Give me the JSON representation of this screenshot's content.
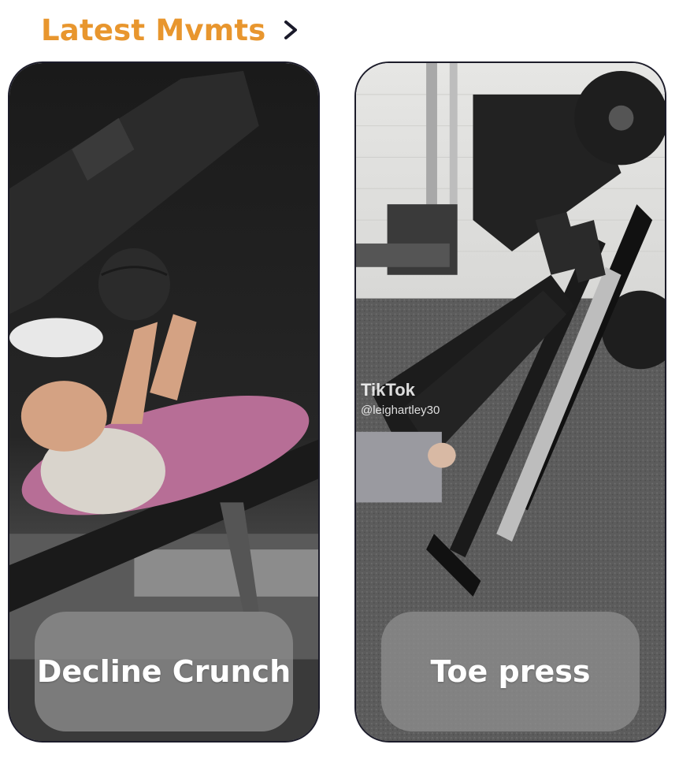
{
  "section": {
    "title": "Latest Mvmts",
    "chevron_icon": "chevron-right-icon"
  },
  "cards": [
    {
      "label": "Decline Crunch"
    },
    {
      "label": "Toe press",
      "watermark_brand": "TikTok",
      "watermark_handle": "@leighartley30"
    }
  ],
  "colors": {
    "accent": "#E8962E",
    "card_border": "#1c1c2a",
    "pill_bg": "rgba(140,140,140,0.80)"
  }
}
